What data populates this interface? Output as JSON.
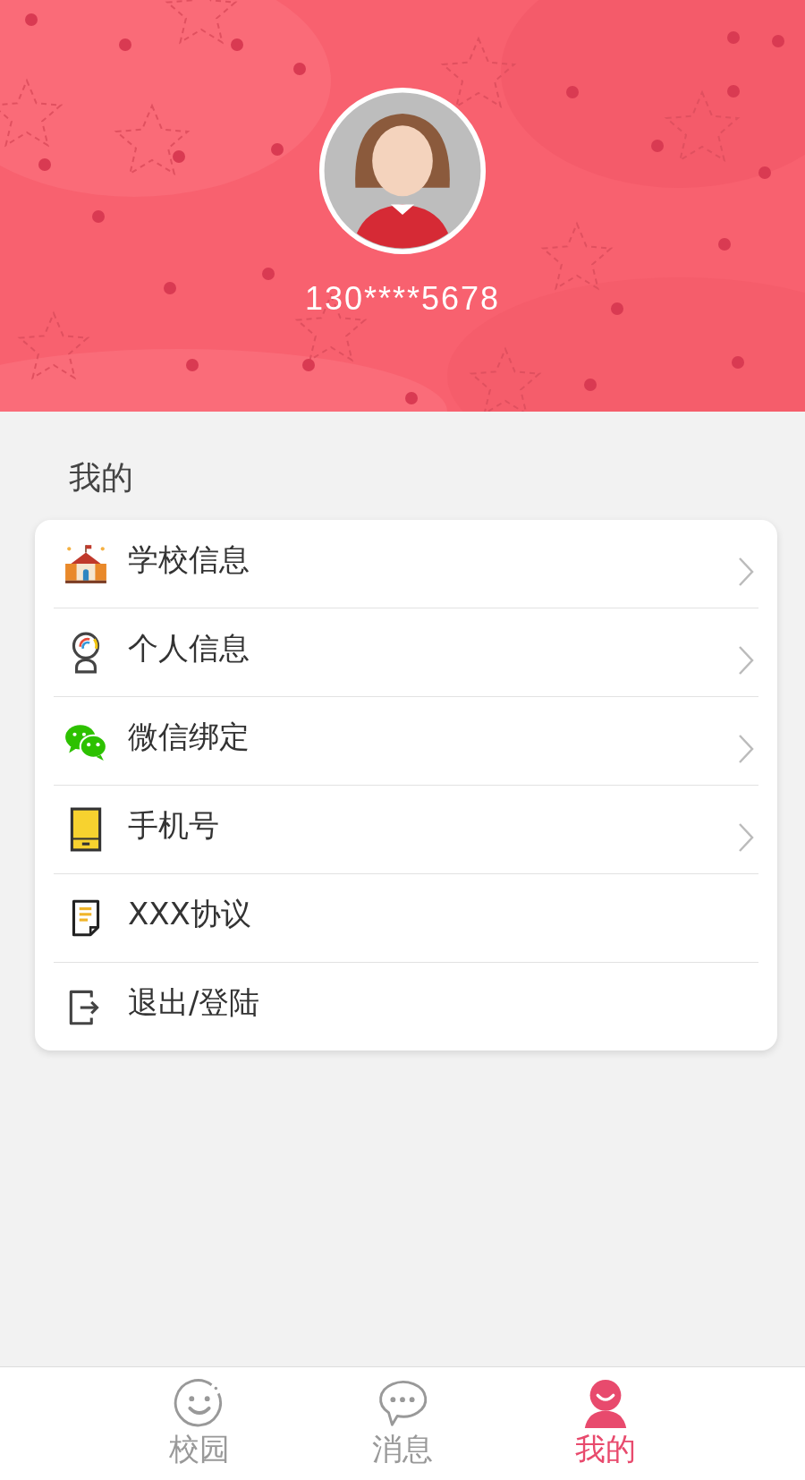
{
  "profile": {
    "phone": "130****5678"
  },
  "section_title": "我的",
  "menu": [
    {
      "kind": "school",
      "label": "学校信息",
      "arrow": true
    },
    {
      "kind": "person",
      "label": "个人信息",
      "arrow": true
    },
    {
      "kind": "wechat",
      "label": "微信绑定",
      "arrow": true
    },
    {
      "kind": "phone",
      "label": "手机号",
      "arrow": true
    },
    {
      "kind": "document",
      "label": "XXX协议",
      "arrow": false
    },
    {
      "kind": "logout",
      "label": "退出/登陆",
      "arrow": false
    }
  ],
  "tabs": [
    {
      "kind": "smile",
      "label": "校园",
      "selected": false
    },
    {
      "kind": "chat",
      "label": "消息",
      "selected": false
    },
    {
      "kind": "user",
      "label": "我的",
      "selected": true
    }
  ]
}
